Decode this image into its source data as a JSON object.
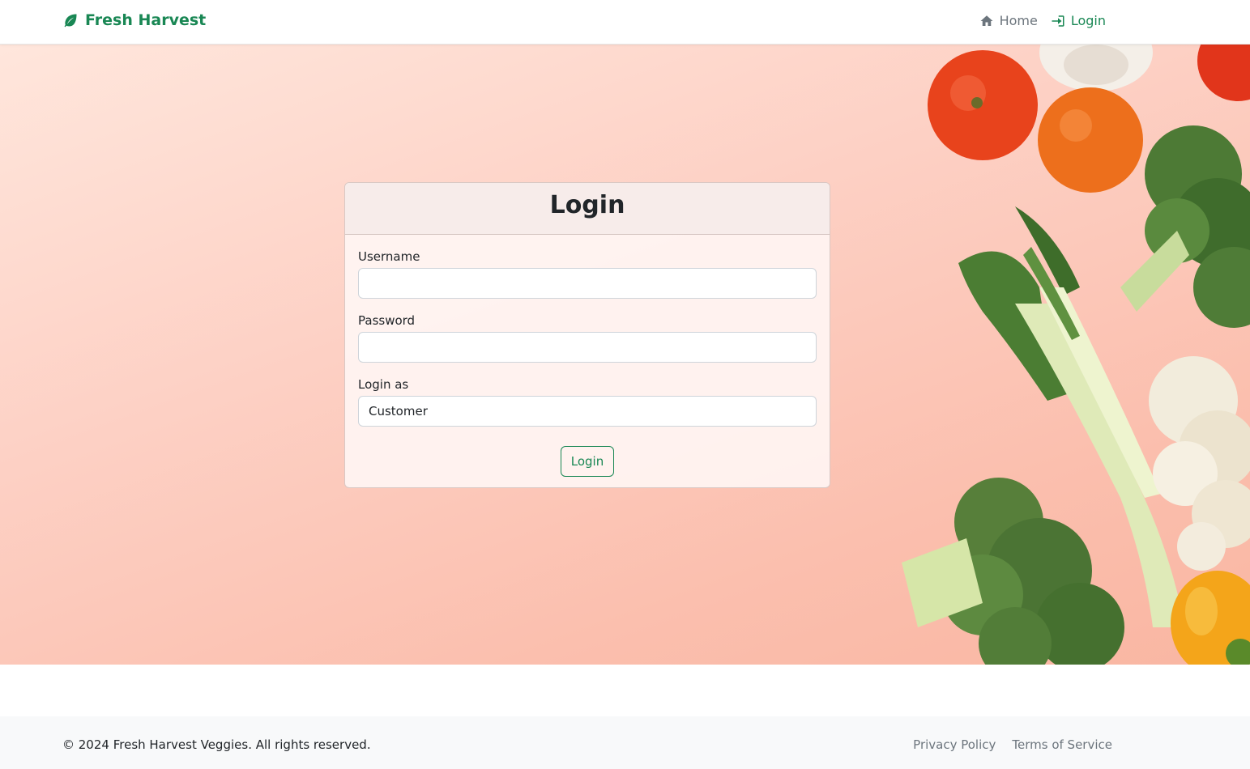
{
  "navbar": {
    "brand": "Fresh Harvest",
    "brand_icon": "leaf-icon",
    "brand_color": "#198754",
    "links": [
      {
        "label": "Home",
        "icon": "house-icon"
      },
      {
        "label": "Login",
        "icon": "sign-in-icon"
      }
    ]
  },
  "login_card": {
    "title": "Login",
    "username": {
      "label": "Username",
      "value": ""
    },
    "password": {
      "label": "Password",
      "value": ""
    },
    "role": {
      "label": "Login as",
      "selected": "Customer"
    },
    "submit_label": "Login"
  },
  "footer": {
    "copyright": "© 2024 Fresh Harvest Veggies. All rights reserved.",
    "links": [
      "Privacy Policy",
      "Terms of Service"
    ]
  },
  "colors": {
    "accent": "#198754",
    "muted": "#6c757d",
    "hero_bg": "#fbc6b6"
  }
}
